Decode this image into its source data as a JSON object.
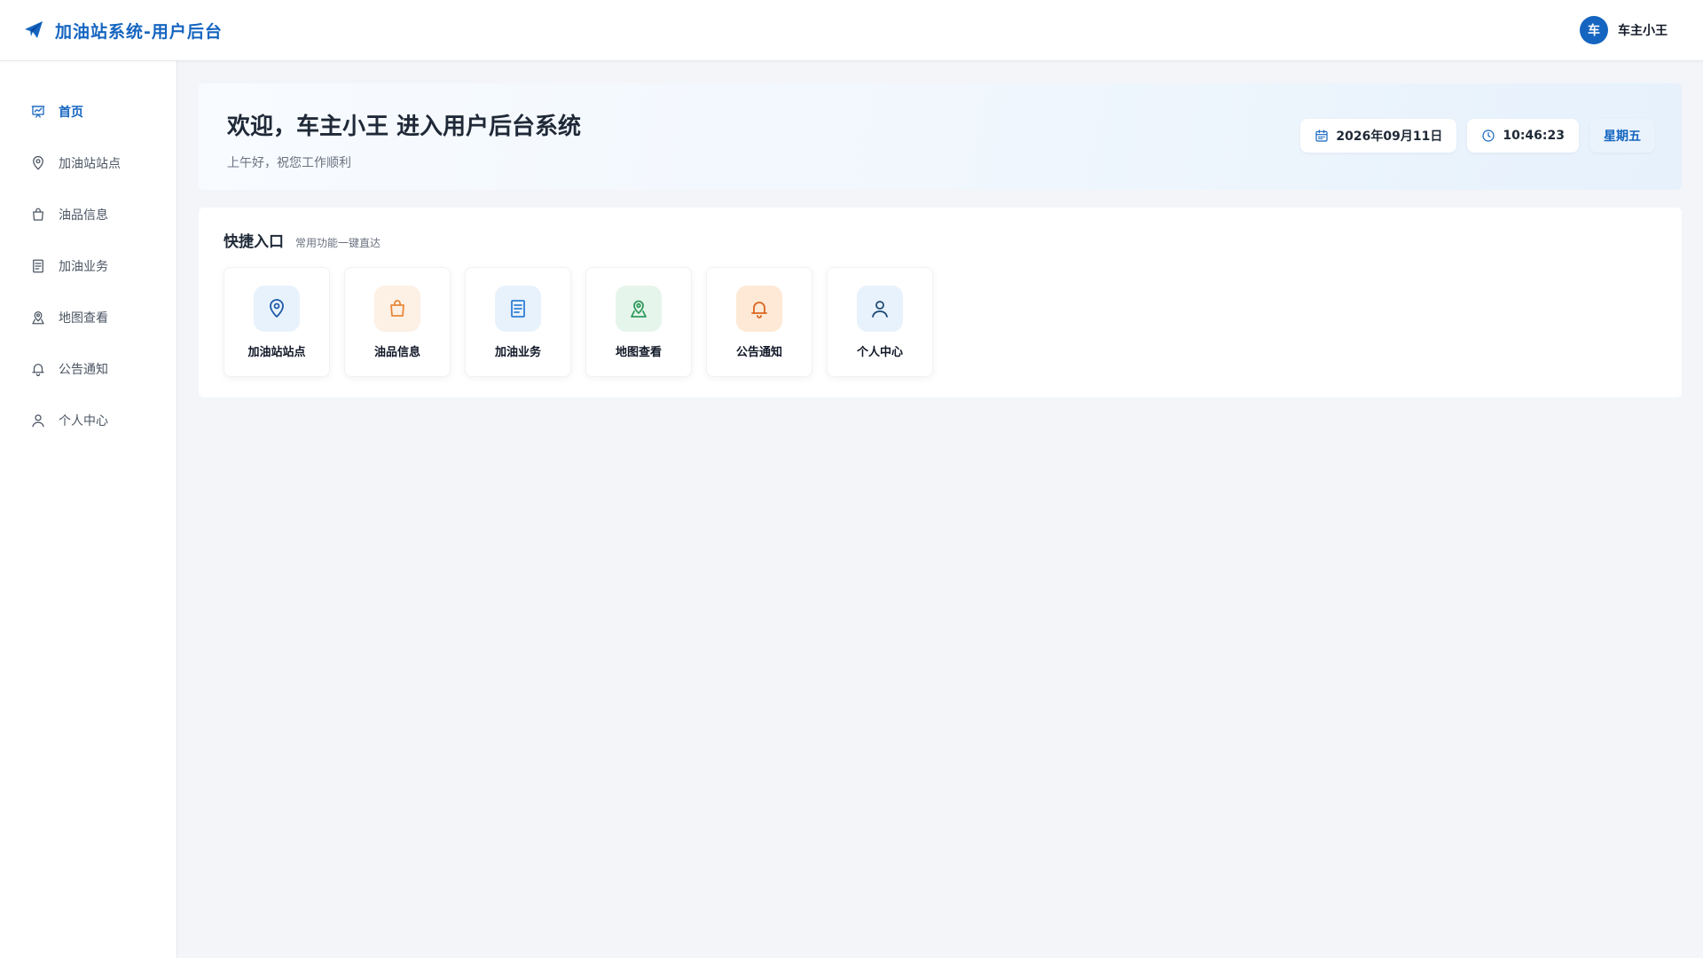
{
  "header": {
    "title": "加油站系统-用户后台",
    "user": {
      "avatar_text": "车",
      "name": "车主小王"
    }
  },
  "sidebar": {
    "items": [
      {
        "label": "首页",
        "icon": "presentation-chart-icon",
        "active": true
      },
      {
        "label": "加油站站点",
        "icon": "location-pin-icon"
      },
      {
        "label": "油品信息",
        "icon": "shopping-bag-icon"
      },
      {
        "label": "加油业务",
        "icon": "document-icon"
      },
      {
        "label": "地图查看",
        "icon": "map-location-icon"
      },
      {
        "label": "公告通知",
        "icon": "bell-icon"
      },
      {
        "label": "个人中心",
        "icon": "user-icon"
      }
    ]
  },
  "welcome": {
    "title": "欢迎，车主小王 进入用户后台系统",
    "subtitle": "上午好，祝您工作顺利",
    "date": "2026年09月11日",
    "time": "10:46:23",
    "weekday": "星期五"
  },
  "quick": {
    "title": "快捷入口",
    "subtitle": "常用功能一键直达",
    "items": [
      {
        "label": "加油站站点",
        "icon": "location-pin-icon",
        "color": "#1e5aa8",
        "bg": "#e8f2fc"
      },
      {
        "label": "油品信息",
        "icon": "shopping-bag-icon",
        "color": "#e8883a",
        "bg": "#fdf0e4"
      },
      {
        "label": "加油业务",
        "icon": "document-icon",
        "color": "#2f7fd4",
        "bg": "#e8f2fc"
      },
      {
        "label": "地图查看",
        "icon": "map-location-icon",
        "color": "#2e9a5c",
        "bg": "#e6f5ec"
      },
      {
        "label": "公告通知",
        "icon": "bell-icon",
        "color": "#d9651f",
        "bg": "#fde9d6"
      },
      {
        "label": "个人中心",
        "icon": "user-icon",
        "color": "#1e4a78",
        "bg": "#e8f2fc"
      }
    ]
  },
  "colors": {
    "primary": "#1565c0",
    "background": "#f3f5f9"
  }
}
